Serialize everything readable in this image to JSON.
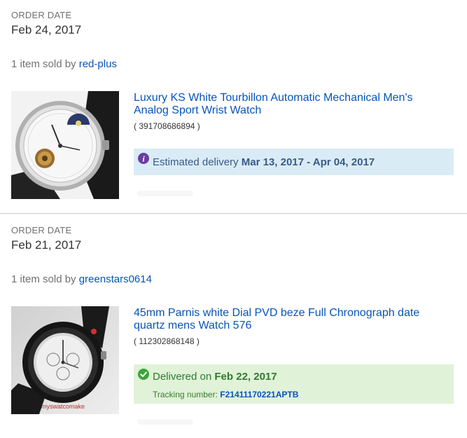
{
  "orders": [
    {
      "order_date_label": "ORDER DATE",
      "order_date": "Feb 24, 2017",
      "sold_prefix": "1 item sold by",
      "seller": "red-plus",
      "item_title": "Luxury KS White Tourbillon Automatic Mechanical Men's Analog Sport Wrist Watch",
      "item_id": "( 391708686894 )",
      "status": {
        "type": "estimated",
        "icon": "info-icon",
        "label": "Estimated delivery",
        "value": "Mar 13, 2017 - Apr 04, 2017",
        "color": "#d9ecf6"
      }
    },
    {
      "order_date_label": "ORDER DATE",
      "order_date": "Feb 21, 2017",
      "sold_prefix": "1 item sold by",
      "seller": "greenstars0614",
      "item_title": "45mm Parnis white Dial PVD beze Full Chronograph date quartz mens Watch 576",
      "item_id": "( 112302868148 )",
      "status": {
        "type": "delivered",
        "icon": "check-circle-icon",
        "label": "Delivered on",
        "value": "Feb 22, 2017",
        "tracking_label": "Tracking number:",
        "tracking_number": "F21411170221APTB",
        "color": "#e0f2d8"
      },
      "image_watermark": "myswatcomake"
    }
  ],
  "colors": {
    "link": "#0654ba",
    "muted": "#707070",
    "info_icon": "#6a3ea1",
    "check_icon": "#3aa53a"
  }
}
